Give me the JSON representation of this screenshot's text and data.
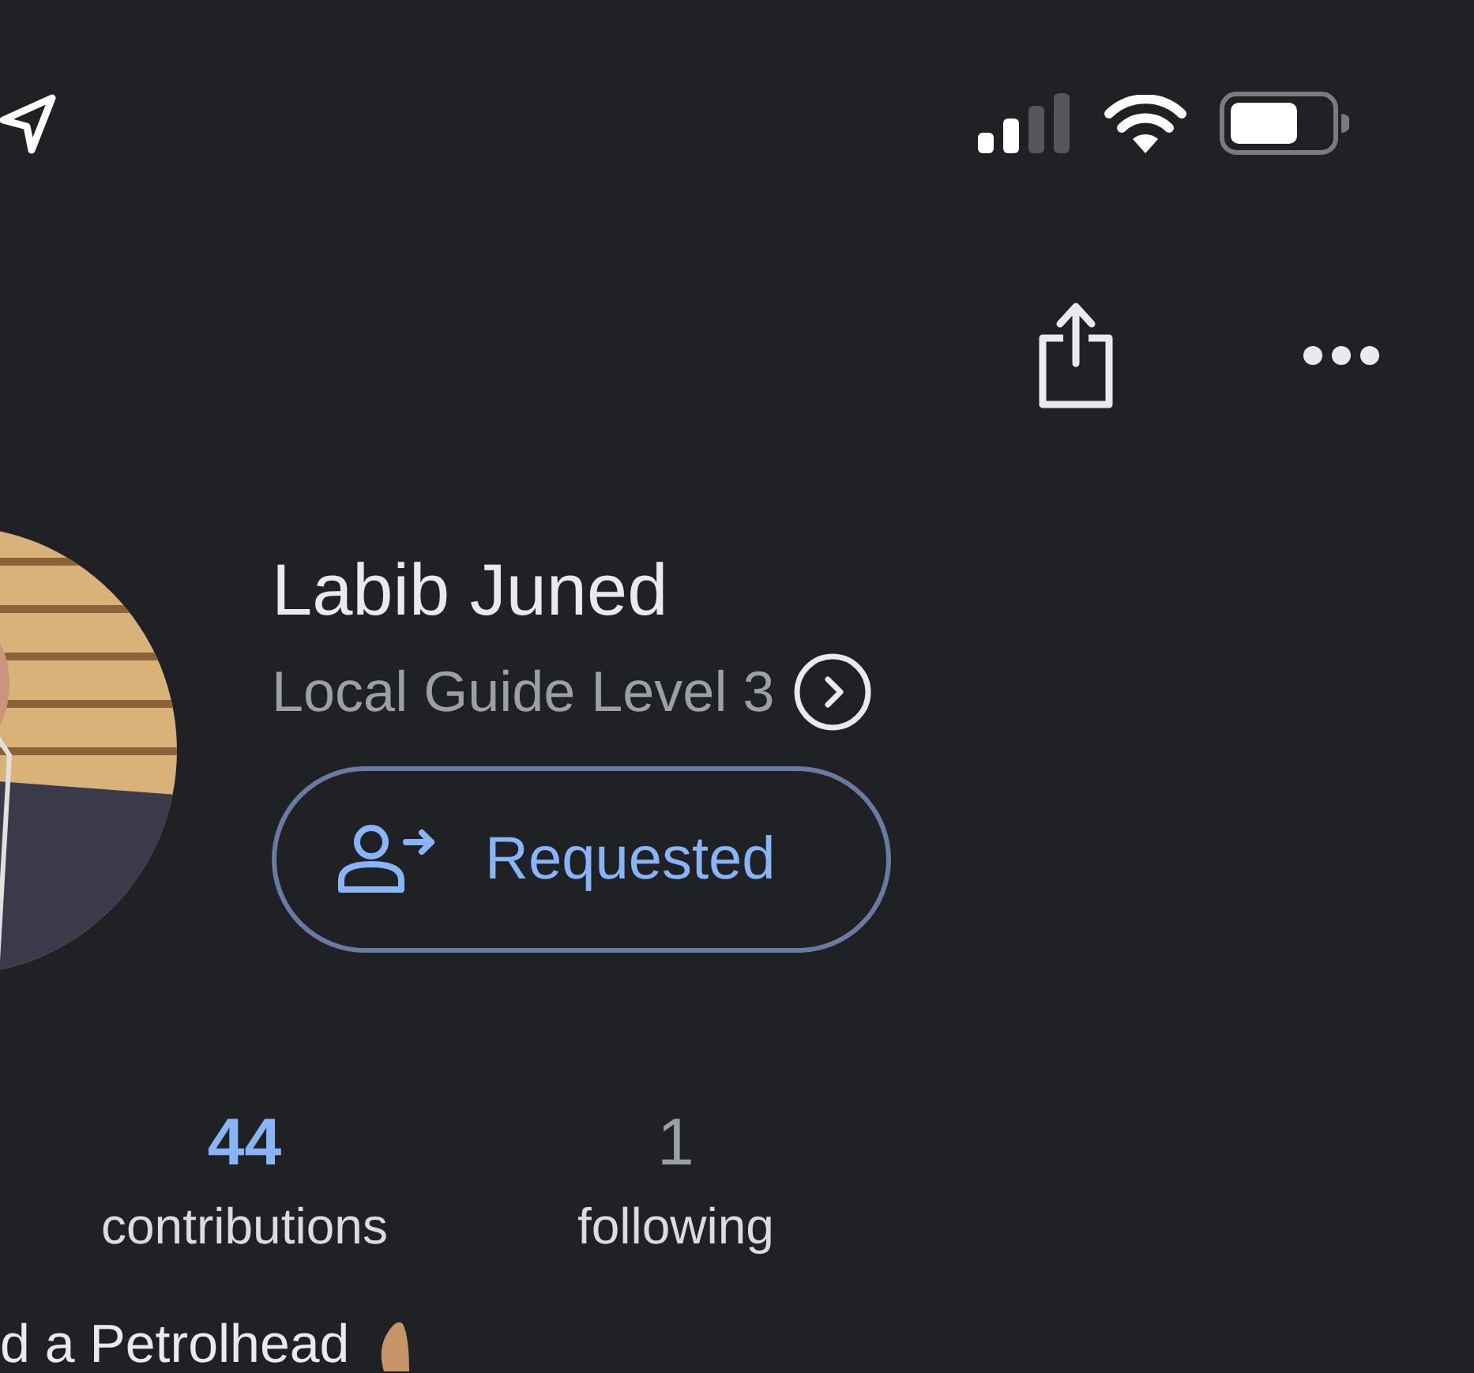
{
  "profile": {
    "name": "Labib Juned",
    "level_label": "Local Guide Level 3",
    "follow_button": {
      "label": "Requested"
    }
  },
  "stats": [
    {
      "value": "44",
      "label": "contributions",
      "kind": "link"
    },
    {
      "value": "1",
      "label": "following",
      "kind": "plain"
    }
  ],
  "bio": "d a Petrolhead"
}
